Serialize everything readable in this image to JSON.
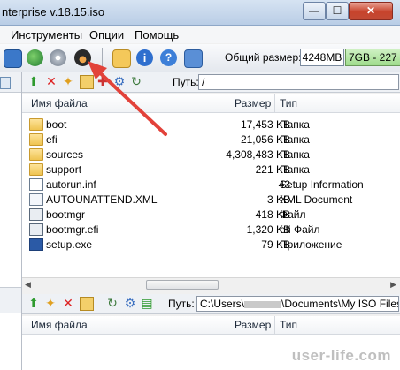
{
  "window": {
    "title": "nterprise v.18.15.iso",
    "minimize": "—",
    "maximize": "☐",
    "close": "✕"
  },
  "menu": {
    "items": [
      {
        "label": "Инструменты"
      },
      {
        "label": "Опции"
      },
      {
        "label": "Помощь"
      }
    ]
  },
  "toolbar": {
    "size_label": "Общий размер:",
    "size_value": "4248MB",
    "capacity_text": "7GB - 227",
    "icons": [
      "mount-icon",
      "disc-globe-icon",
      "burn-icon",
      "burn-glasses-icon",
      "add-file-icon",
      "info-icon",
      "help-icon",
      "exit-icon"
    ]
  },
  "top_pane": {
    "path_label": "Путь:",
    "path_value": "/",
    "columns": {
      "name": "Имя файла",
      "size": "Размер",
      "type": "Тип"
    },
    "rows": [
      {
        "name": "boot",
        "size": "17,453 KB",
        "type": "Папка",
        "icon": "folder"
      },
      {
        "name": "efi",
        "size": "21,056 KB",
        "type": "Папка",
        "icon": "folder"
      },
      {
        "name": "sources",
        "size": "4,308,483 KB",
        "type": "Папка",
        "icon": "folder"
      },
      {
        "name": "support",
        "size": "221 KB",
        "type": "Папка",
        "icon": "folder"
      },
      {
        "name": "autorun.inf",
        "size": "43",
        "type": "Setup Information",
        "icon": "setup"
      },
      {
        "name": "AUTOUNATTEND.XML",
        "size": "3 KB",
        "type": "XML Document",
        "icon": "doc"
      },
      {
        "name": "bootmgr",
        "size": "418 KB",
        "type": "Файл",
        "icon": "sys"
      },
      {
        "name": "bootmgr.efi",
        "size": "1,320 KB",
        "type": "efi Файл",
        "icon": "sys"
      },
      {
        "name": "setup.exe",
        "size": "79 KB",
        "type": "Приложение",
        "icon": "exe"
      }
    ]
  },
  "bottom_pane": {
    "path_label": "Путь:",
    "path_value": "C:\\Users\\",
    "path_value_rest": "\\Documents\\My ISO Files",
    "columns": {
      "name": "Имя файла",
      "size": "Размер",
      "type": "Тип"
    }
  },
  "watermark": "user-life.com",
  "colors": {
    "annotation_arrow": "#e2423a",
    "folder": "#efc452",
    "capacity_bar": "#9fdc8c"
  }
}
